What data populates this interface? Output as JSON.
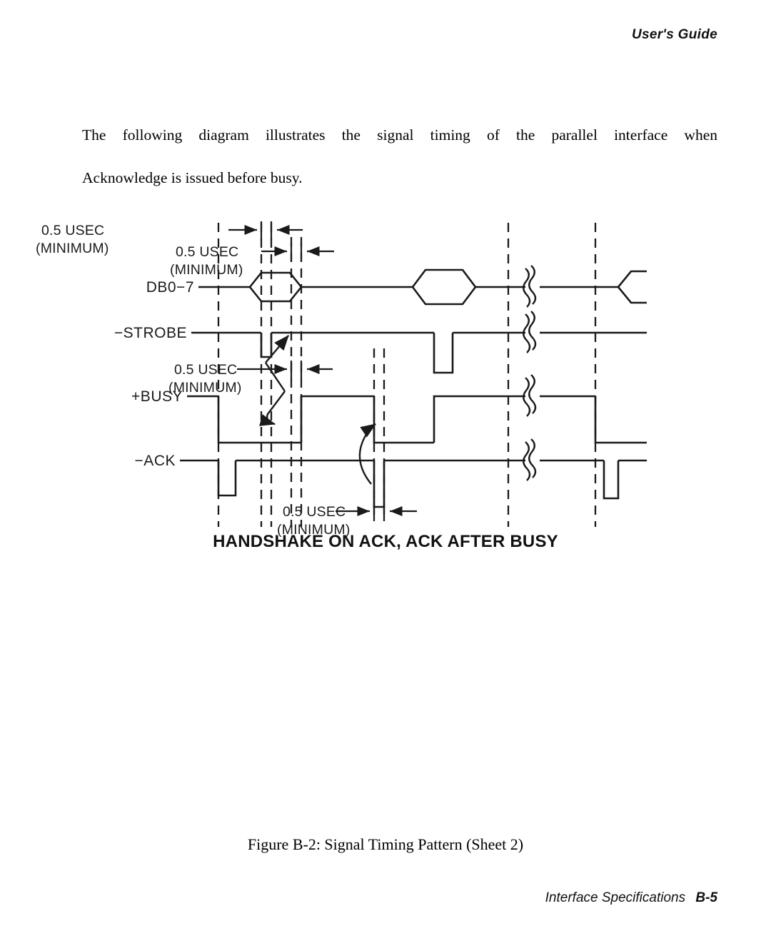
{
  "header": {
    "running_head": "User's Guide"
  },
  "intro": {
    "line1": "The following diagram illustrates the signal timing of the parallel interface when",
    "line2": "Acknowledge is issued before busy."
  },
  "figure": {
    "diagram_title": "HANDSHAKE ON ACK, ACK AFTER BUSY",
    "caption": "Figure B-2:  Signal Timing Pattern (Sheet 2)",
    "signals": [
      {
        "name": "DB0-7",
        "label": "DB0−7"
      },
      {
        "name": "STROBE",
        "label": "−STROBE"
      },
      {
        "name": "BUSY",
        "label": "+BUSY"
      },
      {
        "name": "ACK",
        "label": "−ACK"
      }
    ],
    "annotations": [
      {
        "id": "a1",
        "value": "0.5 USEC",
        "qualifier": "(MINIMUM)"
      },
      {
        "id": "a2",
        "value": "0.5 USEC",
        "qualifier": "(MINIMUM)"
      },
      {
        "id": "a3",
        "value": "0.5 USEC",
        "qualifier": "(MINIMUM)"
      },
      {
        "id": "a4",
        "value": "0.5 USEC",
        "qualifier": "(MINIMUM)"
      }
    ]
  },
  "footer": {
    "section": "Interface Specifications",
    "page": "B-5"
  }
}
